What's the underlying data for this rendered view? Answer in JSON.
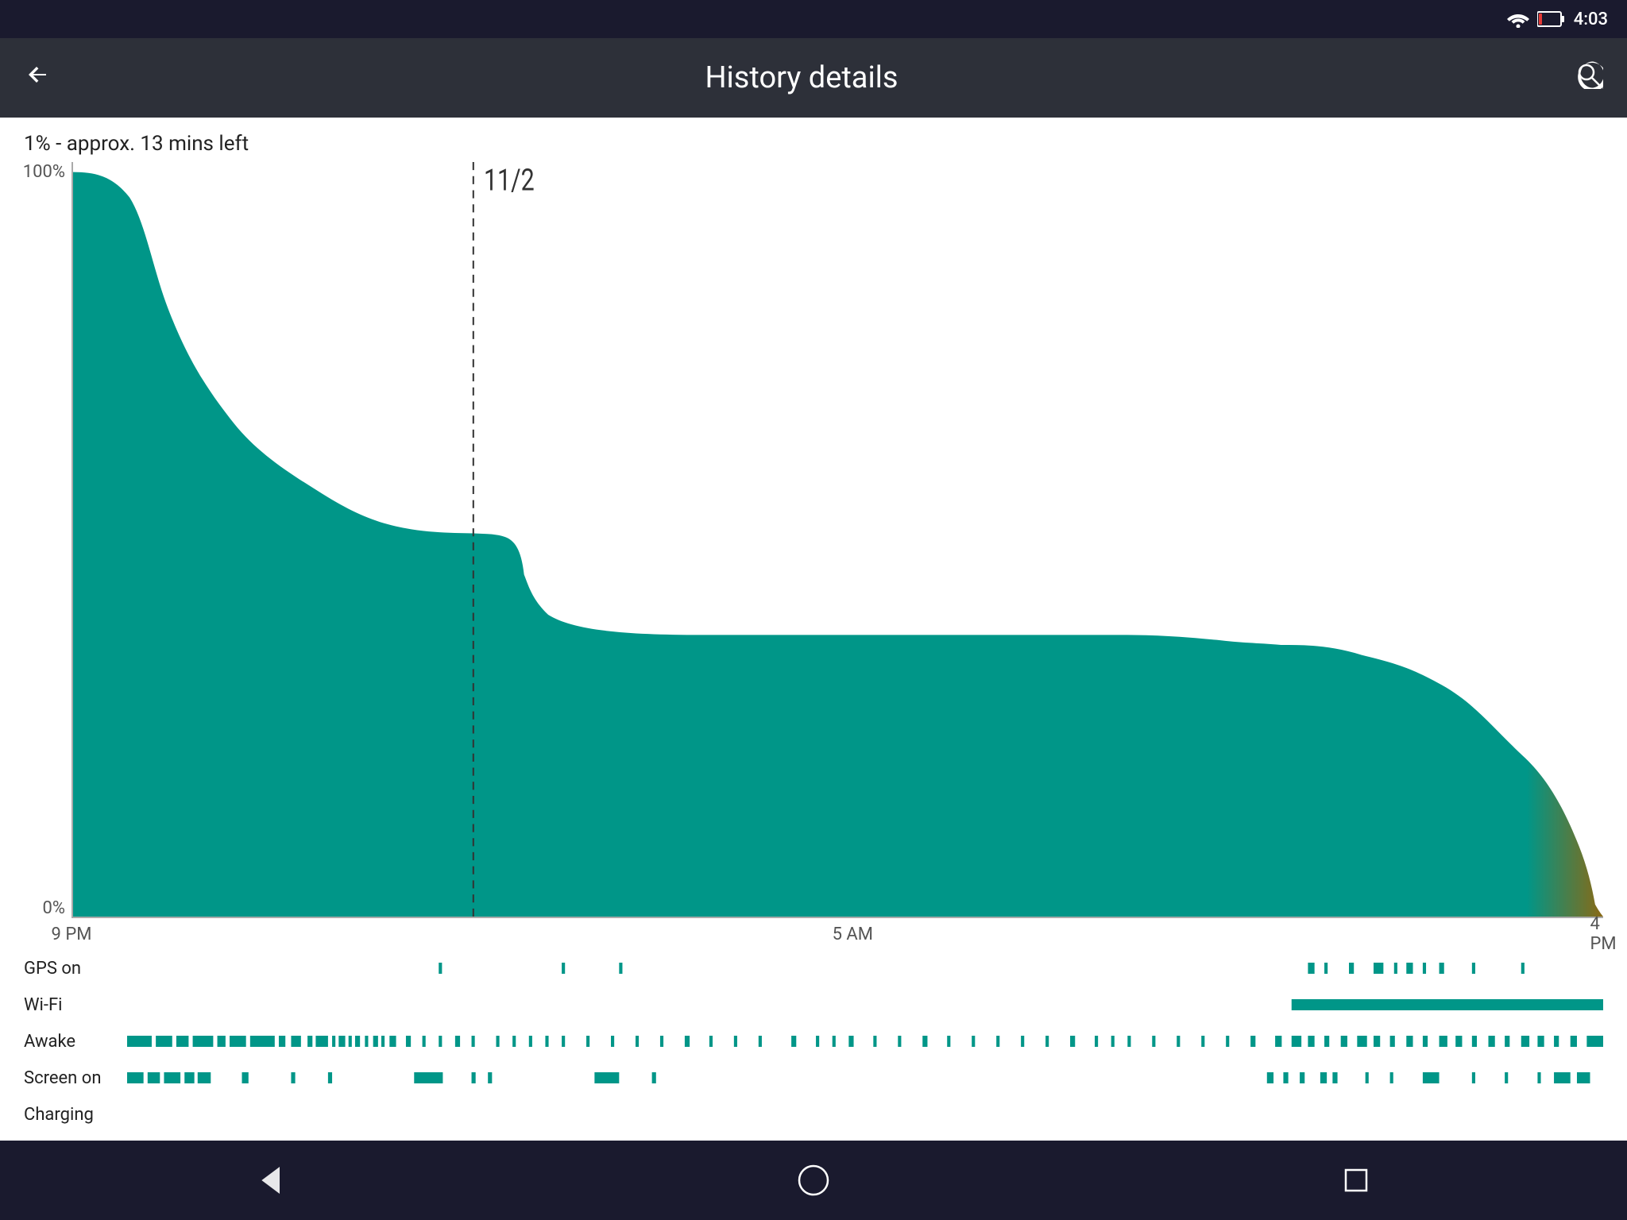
{
  "statusBar": {
    "time": "4:03",
    "wifiIcon": "wifi",
    "batteryIcon": "battery-low"
  },
  "topBar": {
    "title": "History details",
    "backLabel": "←",
    "searchLabel": "🔍"
  },
  "batteryStatus": {
    "text": "1% - approx. 13 mins left"
  },
  "chart": {
    "yLabels": [
      "100%",
      "0%"
    ],
    "dateLine": "11/2",
    "xLabels": [
      {
        "label": "9 PM",
        "pct": 0
      },
      {
        "label": "5 AM",
        "pct": 51
      },
      {
        "label": "4 PM",
        "pct": 100
      }
    ]
  },
  "events": [
    {
      "label": "GPS on"
    },
    {
      "label": "Wi-Fi"
    },
    {
      "label": "Awake"
    },
    {
      "label": "Screen on"
    },
    {
      "label": "Charging"
    }
  ],
  "navBar": {
    "back": "◁",
    "home": "○",
    "recents": "□"
  }
}
